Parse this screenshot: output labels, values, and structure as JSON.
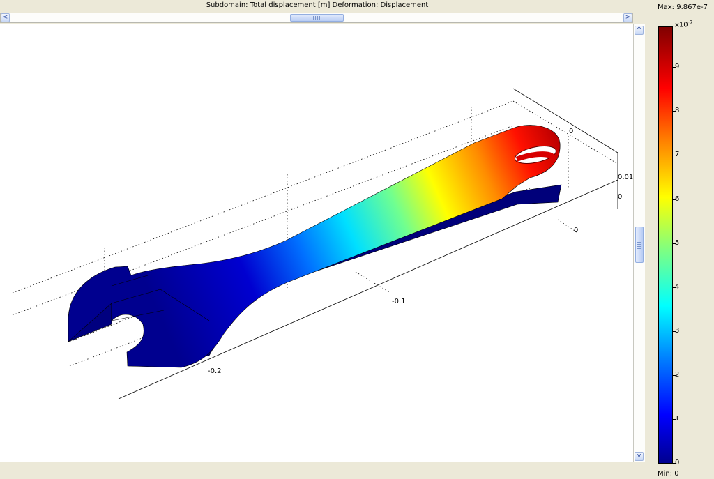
{
  "title": "Subdomain: Total displacement [m]   Deformation: Displacement",
  "hscroll": {
    "left_arrow": "<",
    "right_arrow": ">"
  },
  "vscroll": {
    "up_arrow": "^",
    "down_arrow": "v"
  },
  "axes": {
    "x_ticks": [
      "-0.2",
      "-0.1",
      "0"
    ],
    "y_tick": "0",
    "z_ticks": [
      "0.01",
      "0"
    ]
  },
  "colorbar": {
    "max_label": "Max: 9.867e-7",
    "min_label": "Min: 0",
    "multiplier": "x10",
    "exponent": "-7",
    "ticks": [
      "9",
      "8",
      "7",
      "6",
      "5",
      "4",
      "3",
      "2",
      "1",
      "0"
    ],
    "colors": [
      "#00008f",
      "#0000ff",
      "#0080ff",
      "#00ffff",
      "#80ff80",
      "#ffff00",
      "#ff8000",
      "#ff0000",
      "#800000"
    ]
  }
}
